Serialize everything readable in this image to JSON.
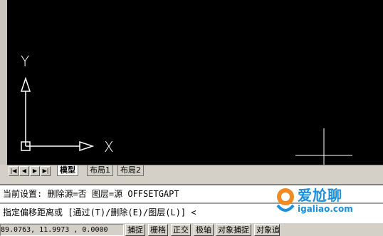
{
  "drawing": {
    "ucs_x_label": "X",
    "ucs_y_label": "Y"
  },
  "layout_tabs": {
    "nav_first": "|◀",
    "nav_prev": "◀",
    "nav_next": "▶",
    "nav_last": "▶|",
    "tabs": [
      {
        "label": "模型",
        "active": true
      },
      {
        "label": "布局1",
        "active": false
      },
      {
        "label": "布局2",
        "active": false
      }
    ]
  },
  "command": {
    "line1": "当前设置: 删除源=否  图层=源  OFFSETGAPT",
    "line2": "指定偏移距离或 [通过(T)/删除(E)/图层(L)] <"
  },
  "status_bar": {
    "coordinates": "89.0763, 11.9973 , 0.0000",
    "buttons": [
      "捕捉",
      "栅格",
      "正交",
      "极轴",
      "对象捕捉",
      "对象追"
    ]
  },
  "watermark": {
    "brand": "爱尬聊",
    "site": "igaliao.com",
    "logo": "logo-icon"
  },
  "colors": {
    "canvas": "#000000",
    "chrome": "#d4d0c8",
    "command_bg": "#ffffff",
    "watermark_blue": "#1e8fd8"
  }
}
